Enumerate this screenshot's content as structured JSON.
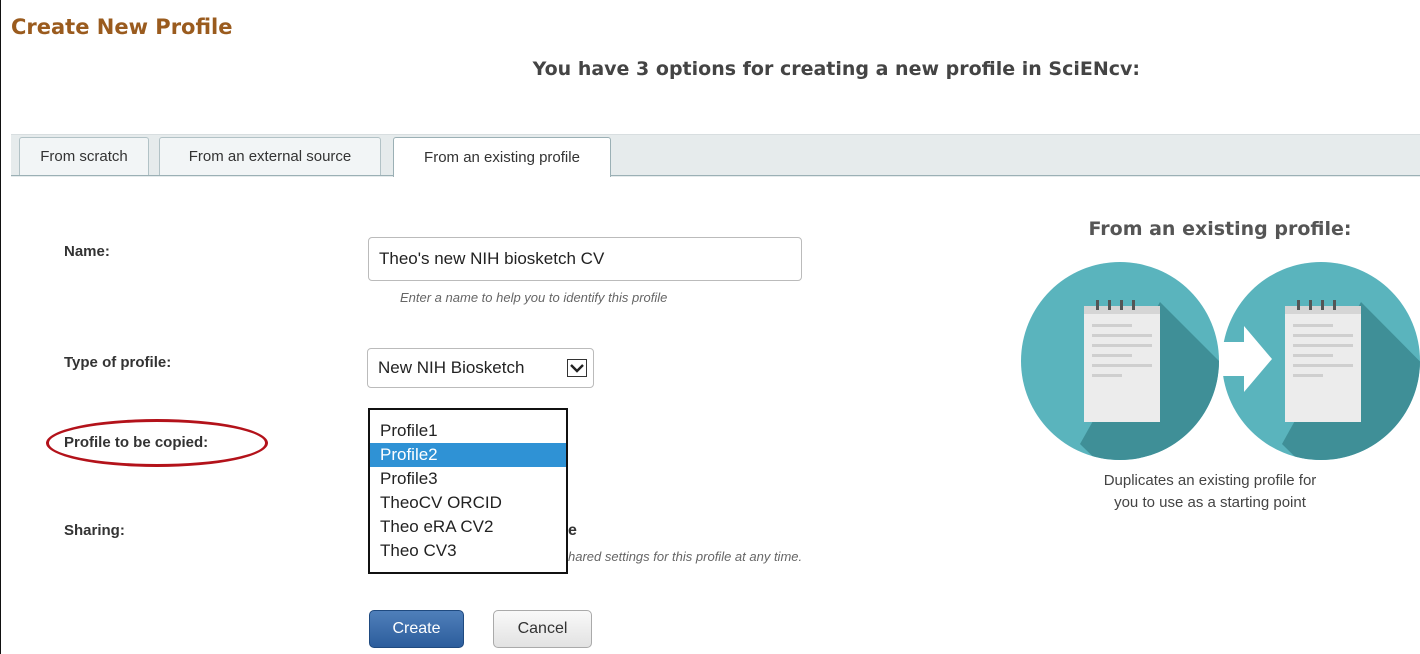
{
  "page": {
    "title": "Create New Profile",
    "subtitle": "You have 3 options for creating a new profile in SciENcv:"
  },
  "tabs": [
    {
      "label": "From scratch",
      "active": false
    },
    {
      "label": "From an external source",
      "active": false
    },
    {
      "label": "From an existing profile",
      "active": true
    }
  ],
  "form": {
    "name": {
      "label": "Name:",
      "value": "Theo's new NIH biosketch CV",
      "hint": "Enter a name to help you to identify this profile"
    },
    "type": {
      "label": "Type of profile:",
      "selected": "New NIH Biosketch"
    },
    "profile_to_copy": {
      "label": "Profile to be copied:",
      "options": [
        "Profile1",
        "Profile2",
        "Profile3",
        "TheoCV ORCID",
        "Theo eRA CV2",
        "Theo CV3"
      ],
      "selected": "Profile2"
    },
    "sharing": {
      "label": "Sharing:",
      "visible_tail": "e",
      "hint_fragment": "hared settings for this profile at any time."
    }
  },
  "buttons": {
    "create": "Create",
    "cancel": "Cancel"
  },
  "illustration": {
    "title": "From an existing profile:",
    "caption_line1": "Duplicates an existing profile for",
    "caption_line2": "you to use as a starting point",
    "icon_left": "notepad-icon",
    "icon_right": "notepad-copy-icon",
    "arrow": "arrow-right-icon",
    "colors": {
      "circle": "#5ab4bd",
      "shadow": "#3f8f97",
      "paper": "#eeeeee"
    }
  },
  "highlight": {
    "color": "#b3121a"
  }
}
